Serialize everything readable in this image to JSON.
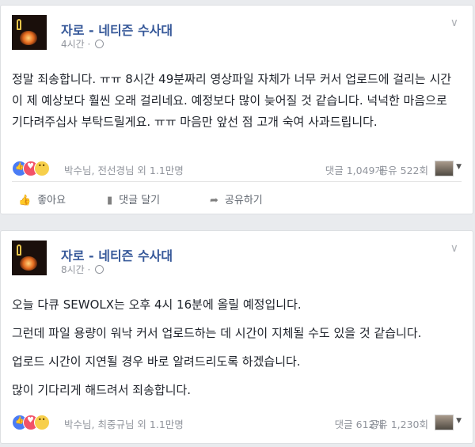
{
  "posts": [
    {
      "page_name": "자로 - 네티즌 수사대",
      "time": "4시간 · ",
      "body_paragraphs": [
        "정말 죄송합니다. ㅠㅠ 8시간 49분짜리 영상파일 자체가 너무 커서 업로드에 걸리는 시간이 제 예상보다 훨씬 오래 걸리네요. 예정보다 많이 늦어질 것 같습니다. 넉넉한 마음으로 기다려주십사 부탁드릴게요. ㅠㅠ 마음만 앞선 점 고개 숙여 사과드립니다."
      ],
      "reaction_names": "박수님, 전선경님 외 1.1만명",
      "comment_count": "댓글 1,049개",
      "share_count": "공유 522회"
    },
    {
      "page_name": "자로 - 네티즌 수사대",
      "time": "8시간 · ",
      "body_paragraphs": [
        "오늘 다큐 SEWOLX는 오후 4시 16분에 올릴 예정입니다.",
        "그런데 파일 용량이 워낙 커서 업로드하는 데 시간이 지체될 수도 있을 것 같습니다.",
        "업로드 시간이 지연될 경우 바로 알려드리도록 하겠습니다.",
        "많이 기다리게 해드려서 죄송합니다."
      ],
      "reaction_names": "박수님, 최중규님 외 1.1만명",
      "comment_count": "댓글 612개",
      "share_count": "공유 1,230회"
    }
  ],
  "actions": {
    "like": "좋아요",
    "comment": "댓글 달기",
    "share": "공유하기"
  },
  "colors": {
    "name": "#365899",
    "background": "#e9ebee"
  }
}
